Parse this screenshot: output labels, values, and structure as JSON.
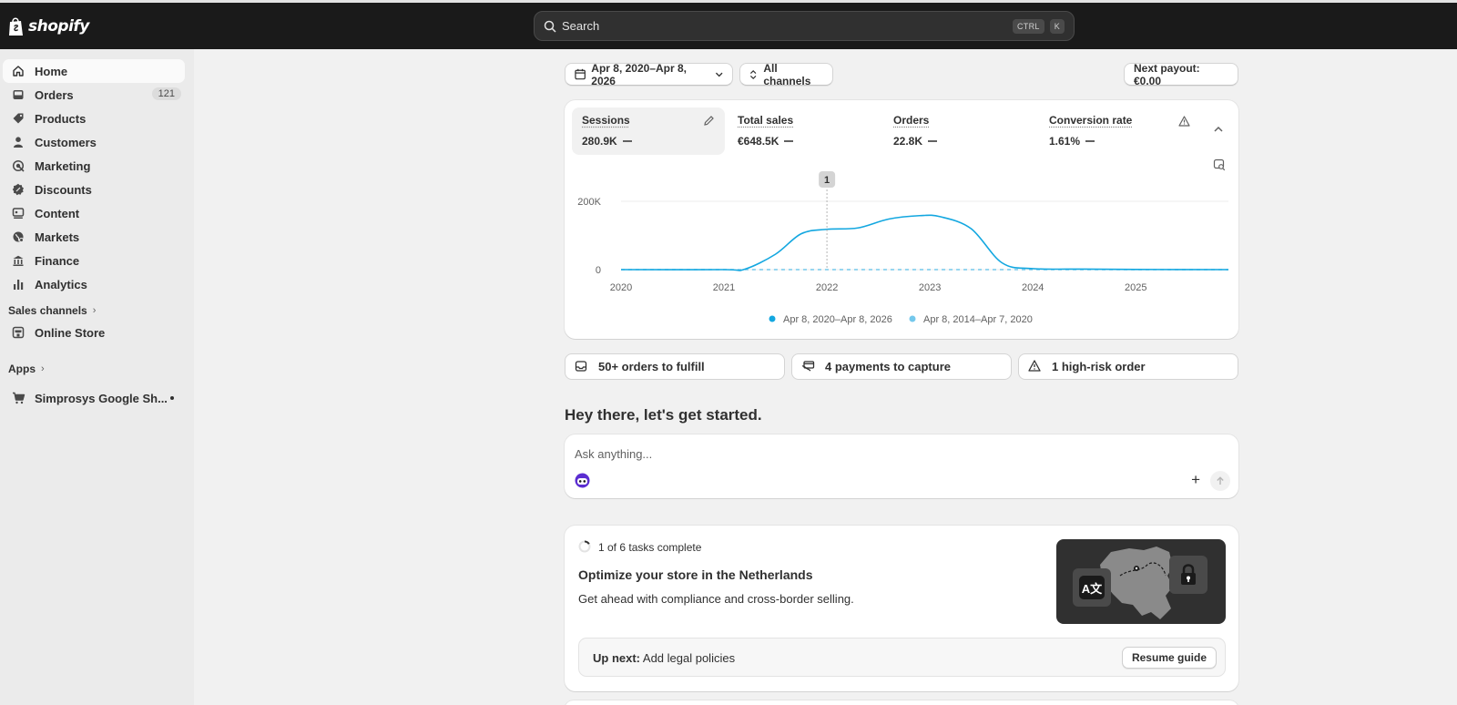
{
  "app": {
    "logo_text": "shopify"
  },
  "search": {
    "placeholder": "Search",
    "shortcut_ctrl": "CTRL",
    "shortcut_key": "K"
  },
  "sidebar": {
    "items": [
      {
        "label": "Home",
        "icon": "home-icon",
        "active": true
      },
      {
        "label": "Orders",
        "icon": "inbox-icon",
        "badge": "121"
      },
      {
        "label": "Products",
        "icon": "tag-icon"
      },
      {
        "label": "Customers",
        "icon": "person-icon"
      },
      {
        "label": "Marketing",
        "icon": "target-icon"
      },
      {
        "label": "Discounts",
        "icon": "discount-icon"
      },
      {
        "label": "Content",
        "icon": "content-icon"
      },
      {
        "label": "Markets",
        "icon": "globe-icon"
      },
      {
        "label": "Finance",
        "icon": "bank-icon"
      },
      {
        "label": "Analytics",
        "icon": "bar-chart-icon"
      }
    ],
    "sales_channels_label": "Sales channels",
    "online_store_label": "Online Store",
    "apps_label": "Apps",
    "app_item_label": "Simprosys Google Sh..."
  },
  "toolbar": {
    "date_range": "Apr 8, 2020–Apr 8, 2026",
    "channels": "All channels",
    "payout": "Next payout: €0.00"
  },
  "metrics": [
    {
      "label": "Sessions",
      "value": "280.9K"
    },
    {
      "label": "Total sales",
      "value": "€648.5K"
    },
    {
      "label": "Orders",
      "value": "22.8K"
    },
    {
      "label": "Conversion rate",
      "value": "1.61%"
    }
  ],
  "chart_data": {
    "type": "line",
    "x_ticks": [
      "2020",
      "2021",
      "2022",
      "2023",
      "2024",
      "2025"
    ],
    "y_ticks": [
      "0",
      "200K"
    ],
    "ylim": [
      0,
      200000
    ],
    "marker_label": "1",
    "marker_x": 2022,
    "series": [
      {
        "name": "Apr 8, 2020–Apr 8, 2026",
        "color": "#13a7e0",
        "style": "solid",
        "points": [
          [
            2020.0,
            0
          ],
          [
            2021.0,
            0
          ],
          [
            2021.2,
            1000
          ],
          [
            2021.5,
            45000
          ],
          [
            2021.75,
            105000
          ],
          [
            2022.0,
            118000
          ],
          [
            2022.3,
            122000
          ],
          [
            2022.6,
            148000
          ],
          [
            2022.9,
            158000
          ],
          [
            2023.1,
            155000
          ],
          [
            2023.4,
            120000
          ],
          [
            2023.7,
            20000
          ],
          [
            2024.0,
            3000
          ],
          [
            2024.5,
            1500
          ],
          [
            2025.0,
            500
          ],
          [
            2025.9,
            0
          ]
        ]
      },
      {
        "name": "Apr 8, 2014–Apr 7, 2020",
        "color": "#74c8ec",
        "style": "dashed",
        "points": [
          [
            2020.0,
            0
          ],
          [
            2025.9,
            0
          ]
        ]
      }
    ]
  },
  "task_buttons": [
    {
      "label": "50+ orders to fulfill",
      "icon": "inbox-icon"
    },
    {
      "label": "4 payments to capture",
      "icon": "card-icon"
    },
    {
      "label": "1 high-risk order",
      "icon": "warning-icon"
    }
  ],
  "greeting": "Hey there, let's get started.",
  "ask": {
    "placeholder": "Ask anything..."
  },
  "guide": {
    "progress": "1 of 6 tasks complete",
    "progress_fraction": 0.1667,
    "title": "Optimize your store in the Netherlands",
    "description": "Get ahead with compliance and cross-border selling.",
    "up_next_label": "Up next:",
    "up_next_value": "Add legal policies",
    "resume_label": "Resume guide",
    "translate_glyph": "A文"
  }
}
